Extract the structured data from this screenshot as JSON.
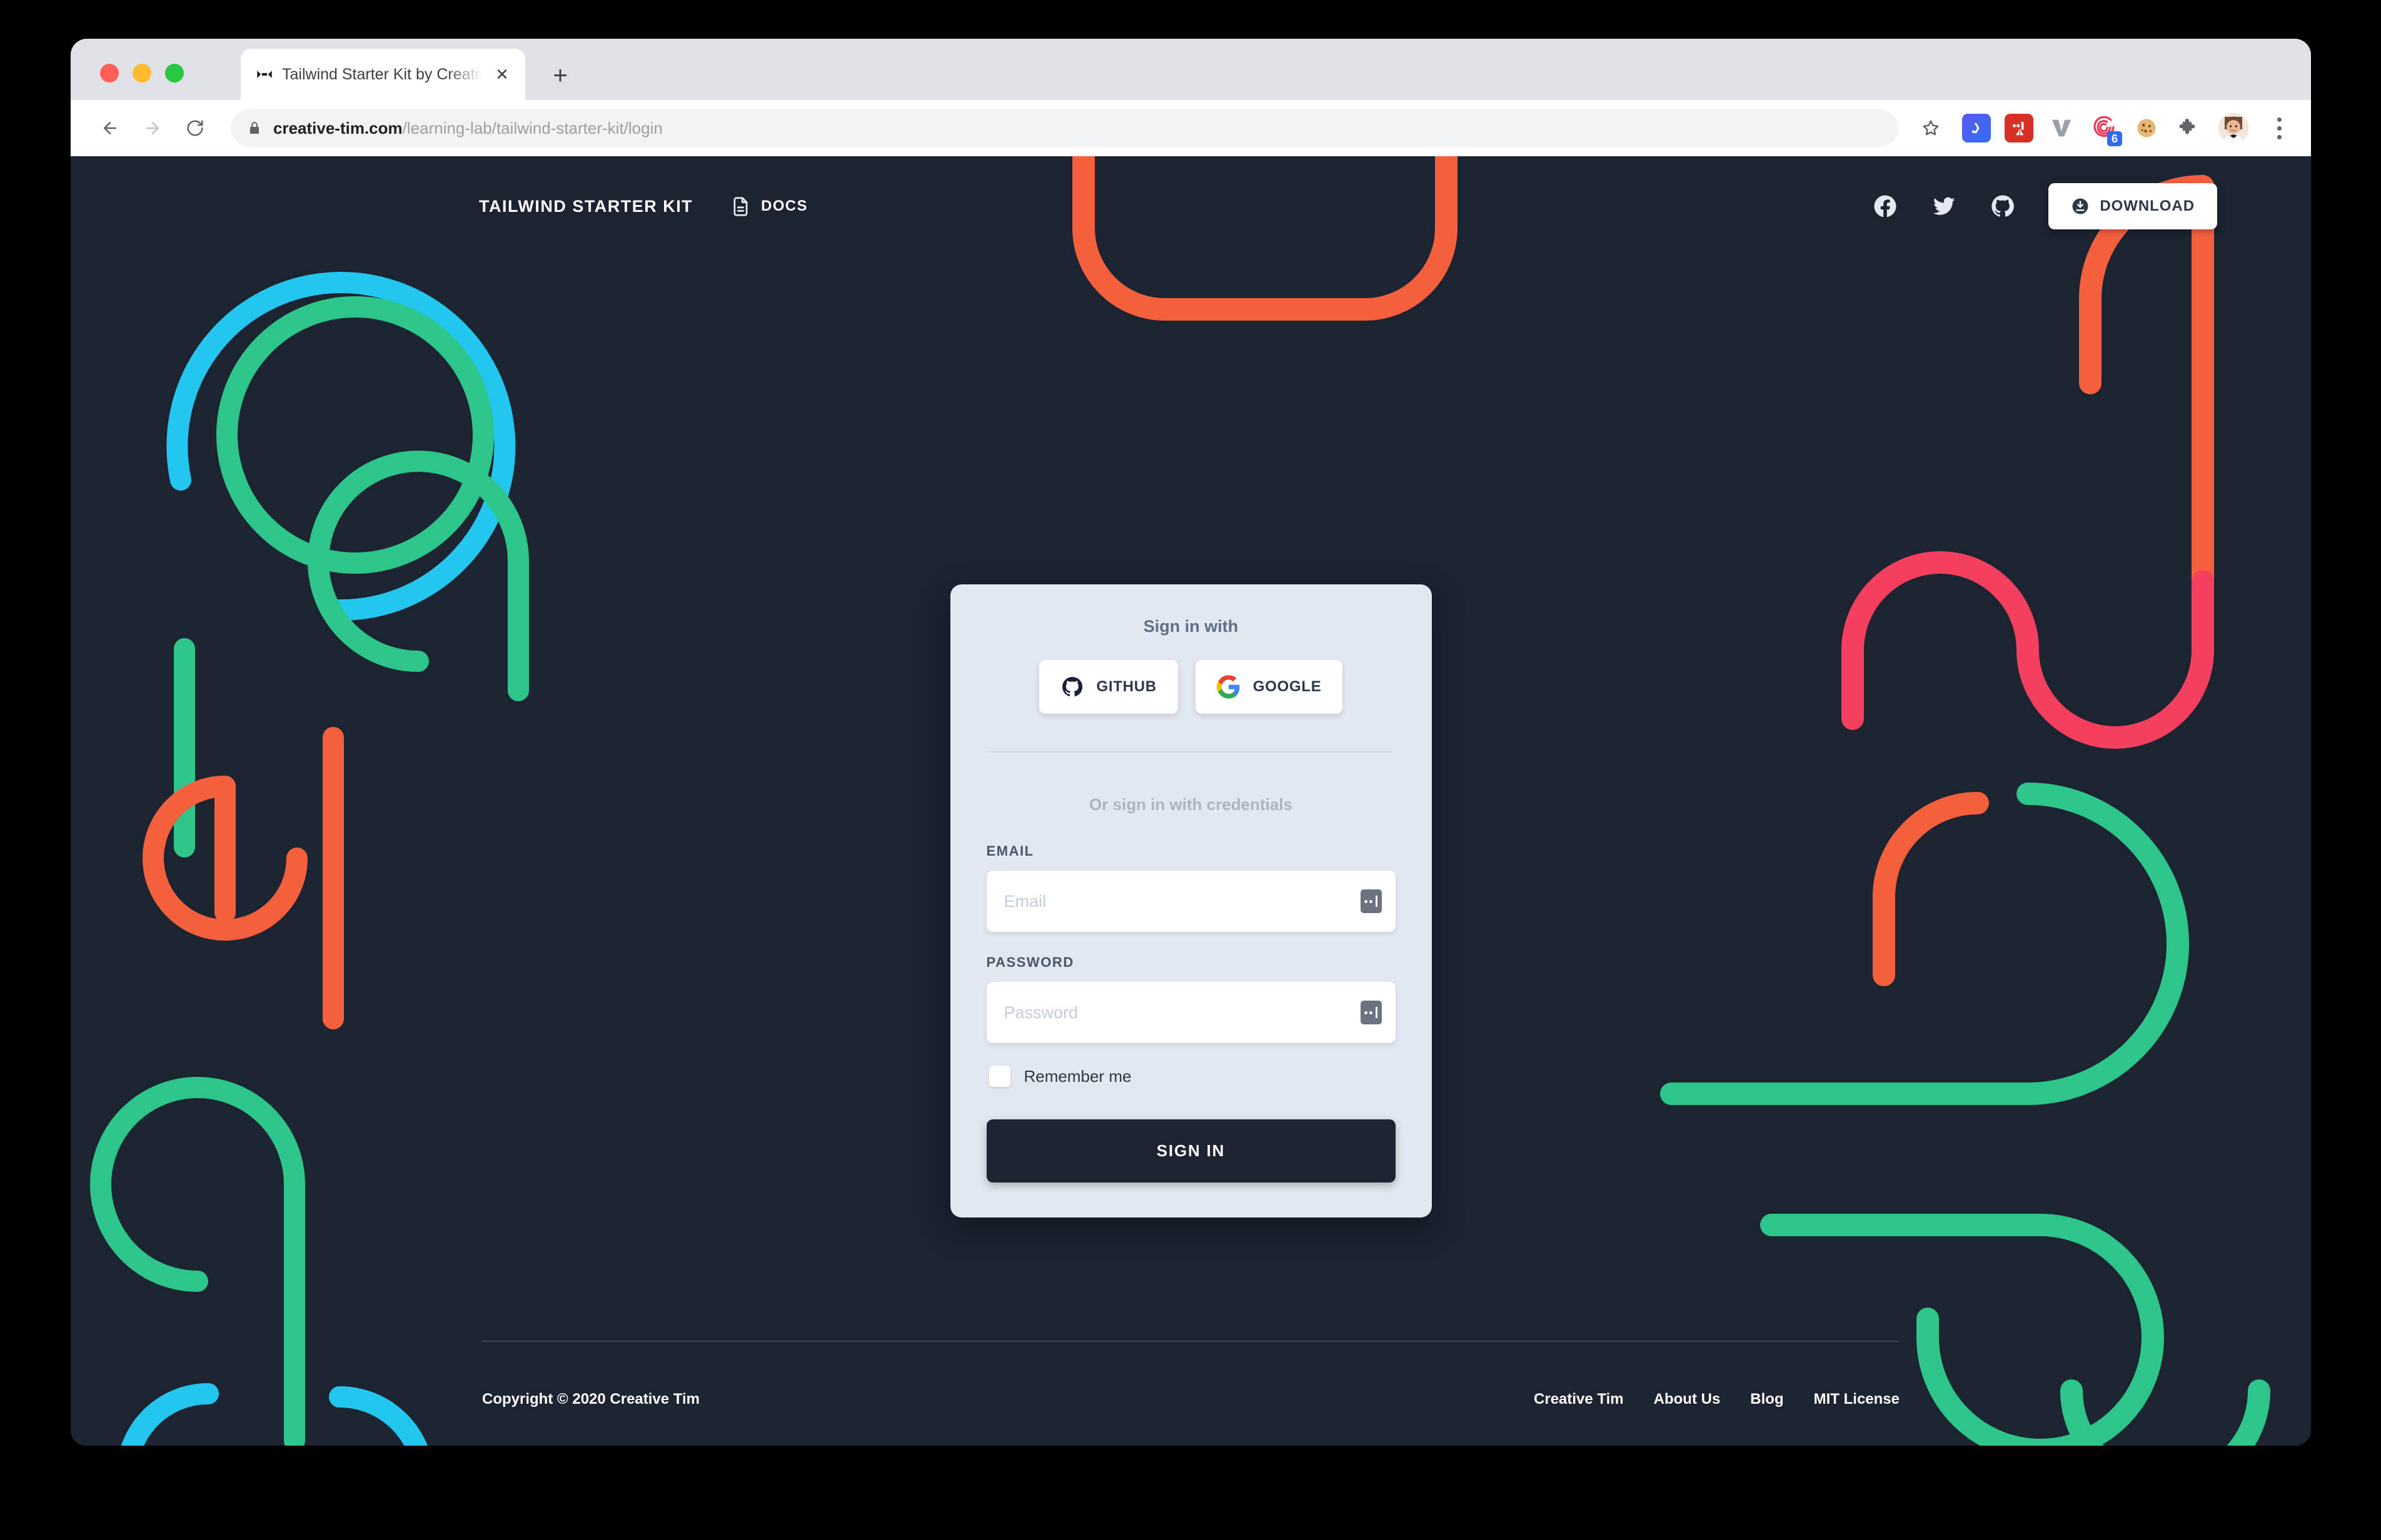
{
  "browser": {
    "tab": {
      "title": "Tailwind Starter Kit by Creative Tim",
      "favicon_name": "bowtie-favicon",
      "close_label": "✕"
    },
    "new_tab_label": "+",
    "nav": {
      "back_label": "Back",
      "forward_label": "Forward",
      "reload_label": "Reload"
    },
    "omnibox": {
      "secure_icon": "lock-icon",
      "url_domain": "creative-tim.com",
      "url_path": "/learning-lab/tailwind-starter-kit/login",
      "bookmark_icon": "star-icon"
    },
    "extensions": [
      {
        "name": "grammarly-extension-icon",
        "badge": ""
      },
      {
        "name": "adblock-warning-extension-icon",
        "badge": ""
      },
      {
        "name": "vimeo-v-extension-icon",
        "badge": ""
      },
      {
        "name": "spiral-extension-icon",
        "badge": "6"
      },
      {
        "name": "cookie-extension-icon",
        "badge": ""
      },
      {
        "name": "puzzle-extensions-icon",
        "badge": ""
      }
    ],
    "profile_icon": "avatar",
    "menu_icon": "three-dot-menu-icon"
  },
  "site": {
    "navbar": {
      "brand": "TAILWIND STARTER KIT",
      "docs_label": "DOCS",
      "docs_icon": "document-icon",
      "social": [
        {
          "name": "facebook-icon"
        },
        {
          "name": "twitter-icon"
        },
        {
          "name": "github-icon"
        }
      ],
      "download_label": "DOWNLOAD",
      "download_icon": "download-circle-icon"
    },
    "login_card": {
      "title": "Sign in with",
      "oauth": [
        {
          "label": "GITHUB",
          "icon": "github-icon"
        },
        {
          "label": "GOOGLE",
          "icon": "google-icon"
        }
      ],
      "credentials_note": "Or sign in with credentials",
      "email": {
        "label": "EMAIL",
        "placeholder": "Email",
        "value": "",
        "autofill_icon": "autofill-icon"
      },
      "password": {
        "label": "PASSWORD",
        "placeholder": "Password",
        "value": "",
        "autofill_icon": "autofill-icon"
      },
      "remember_label": "Remember me",
      "remember_checked": false,
      "submit_label": "SIGN IN"
    },
    "footer": {
      "copyright": "Copyright © 2020 Creative Tim",
      "links": [
        {
          "label": "Creative Tim"
        },
        {
          "label": "About Us"
        },
        {
          "label": "Blog"
        },
        {
          "label": "MIT License"
        }
      ]
    },
    "colors": {
      "page_bg": "#1c2331",
      "card_bg": "#e2e8f0",
      "accent_dark": "#1c2331",
      "deco_cyan": "#22c6ee",
      "deco_green": "#2dc68a",
      "deco_orange": "#f4603e",
      "deco_pink": "#f43f5e"
    }
  }
}
